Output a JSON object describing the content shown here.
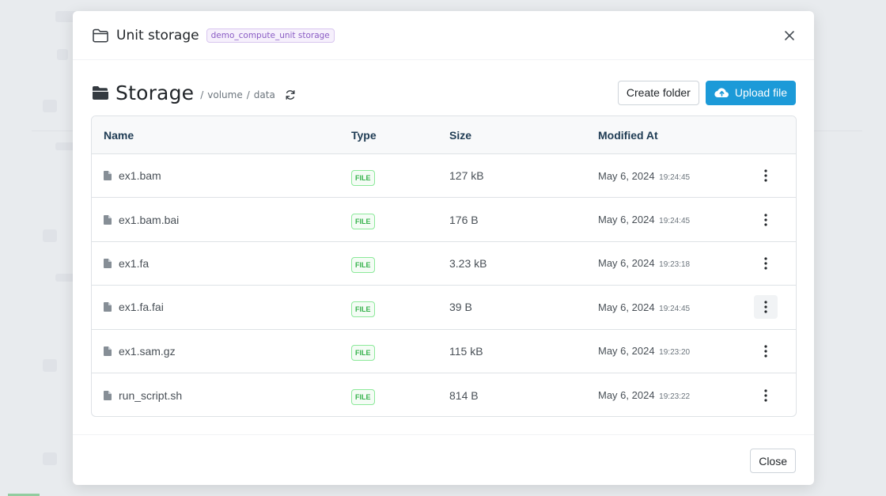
{
  "modal": {
    "title": "Unit storage",
    "scope_badge": "demo_compute_unit storage",
    "close_icon": "close-icon"
  },
  "storage": {
    "title": "Storage",
    "breadcrumb": [
      "/",
      "volume",
      "/",
      "data"
    ],
    "refresh_icon": "refresh-icon"
  },
  "actions": {
    "create_folder": "Create folder",
    "upload_file": "Upload file"
  },
  "table": {
    "columns": [
      "Name",
      "Type",
      "Size",
      "Modified At"
    ],
    "rows": [
      {
        "name": "ex1.bam",
        "type": "FILE",
        "size": "127 kB",
        "date": "May 6, 2024",
        "time": "19:24:45"
      },
      {
        "name": "ex1.bam.bai",
        "type": "FILE",
        "size": "176 B",
        "date": "May 6, 2024",
        "time": "19:24:45"
      },
      {
        "name": "ex1.fa",
        "type": "FILE",
        "size": "3.23 kB",
        "date": "May 6, 2024",
        "time": "19:23:18"
      },
      {
        "name": "ex1.fa.fai",
        "type": "FILE",
        "size": "39 B",
        "date": "May 6, 2024",
        "time": "19:24:45"
      },
      {
        "name": "ex1.sam.gz",
        "type": "FILE",
        "size": "115 kB",
        "date": "May 6, 2024",
        "time": "19:23:20"
      },
      {
        "name": "run_script.sh",
        "type": "FILE",
        "size": "814 B",
        "date": "May 6, 2024",
        "time": "19:23:22"
      }
    ]
  },
  "footer": {
    "close": "Close"
  },
  "colors": {
    "primary": "#1c9ad8",
    "header_text": "#1f3c54",
    "badge_green": "#37b24d",
    "scope_purple": "#8a5cc4"
  }
}
